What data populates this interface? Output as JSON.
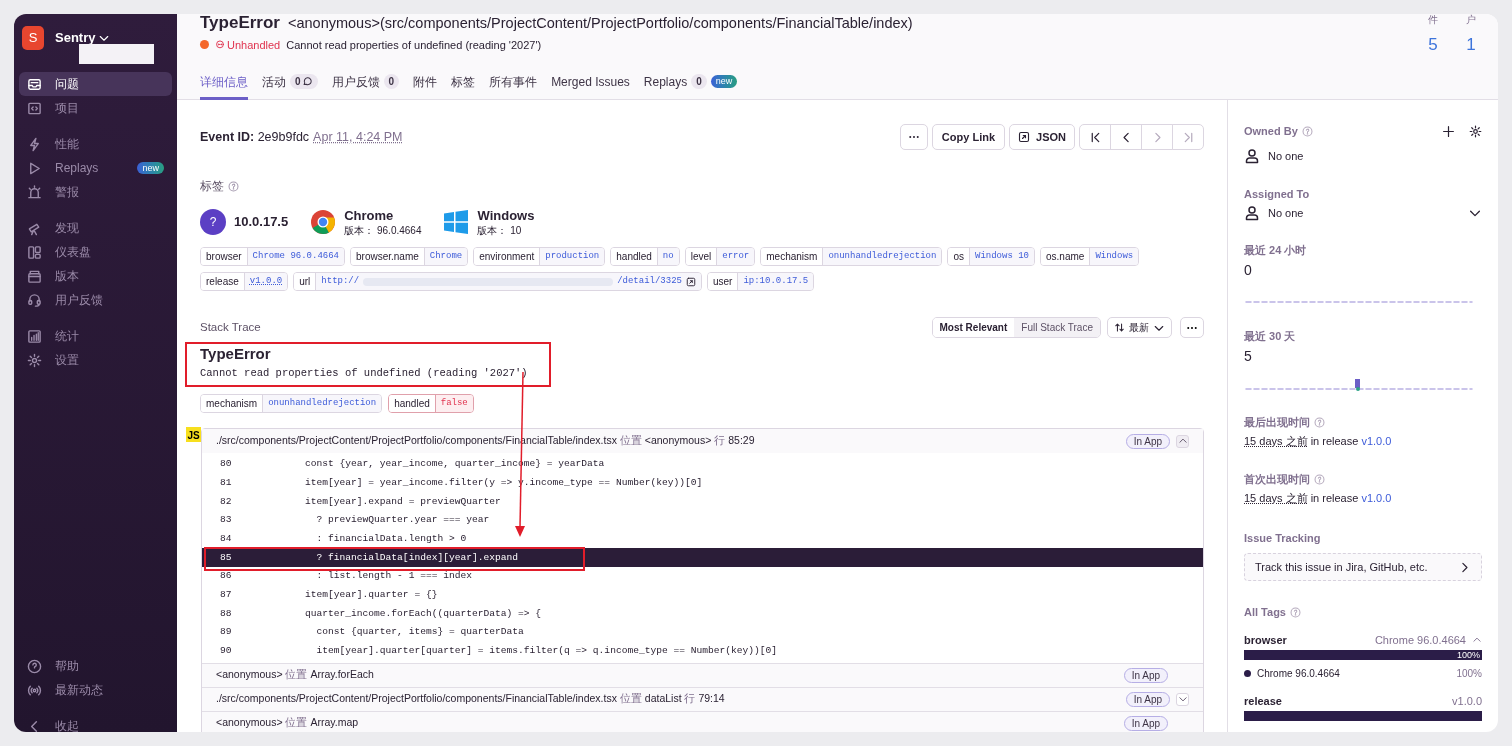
{
  "sidebar": {
    "logo": "S",
    "org": "Sentry",
    "sections": [
      {
        "items": [
          {
            "label": "问题",
            "selected": true
          },
          {
            "label": "项目",
            "selected": false
          }
        ]
      },
      {
        "items": [
          {
            "label": "性能",
            "selected": false
          },
          {
            "label": "Replays",
            "selected": false,
            "badge": "new"
          },
          {
            "label": "警报",
            "selected": false
          }
        ]
      },
      {
        "items": [
          {
            "label": "发现",
            "selected": false
          },
          {
            "label": "仪表盘",
            "selected": false
          },
          {
            "label": "版本",
            "selected": false
          },
          {
            "label": "用户反馈",
            "selected": false
          }
        ]
      },
      {
        "items": [
          {
            "label": "统计",
            "selected": false
          },
          {
            "label": "设置",
            "selected": false
          }
        ]
      }
    ],
    "footer": [
      "帮助",
      "最新动态",
      "收起"
    ]
  },
  "header": {
    "title": "TypeError",
    "subtitle": "<anonymous>(src/components/ProjectContent/ProjectPortfolio/components/FinancialTable/index)",
    "status": "Unhandled",
    "message": "Cannot read properties of undefined (reading '2027')",
    "counts": [
      {
        "label": "件",
        "value": "5"
      },
      {
        "label": "户",
        "value": "1"
      }
    ],
    "tabs": [
      {
        "label": "详细信息",
        "selected": true
      },
      {
        "label": "活动",
        "count": "0",
        "kind": "comments",
        "selected": false
      },
      {
        "label": "用户反馈",
        "count": "0",
        "selected": false
      },
      {
        "label": "附件",
        "selected": false
      },
      {
        "label": "标签",
        "selected": false
      },
      {
        "label": "所有事件",
        "selected": false
      },
      {
        "label": "Merged Issues",
        "selected": false
      },
      {
        "label": "Replays",
        "count": "0",
        "badge": "new",
        "selected": false
      }
    ]
  },
  "event": {
    "id_label": "Event ID:",
    "id": "2e9b9fdc",
    "time": "Apr 11, 4:24 PM",
    "buttons": [
      "Copy Link",
      "JSON"
    ]
  },
  "tags": {
    "title": "标签",
    "highlights": [
      {
        "kind": "user",
        "avatar": "?",
        "title": "10.0.17.5"
      },
      {
        "kind": "browser",
        "title": "Chrome",
        "version_label": "版本：",
        "version": "96.0.4664"
      },
      {
        "kind": "os",
        "title": "Windows",
        "version_label": "版本：",
        "version": "10"
      }
    ],
    "pills": [
      {
        "key": "browser",
        "value": "Chrome 96.0.4664"
      },
      {
        "key": "browser.name",
        "value": "Chrome"
      },
      {
        "key": "environment",
        "value": "production"
      },
      {
        "key": "handled",
        "value": "no"
      },
      {
        "key": "level",
        "value": "error"
      },
      {
        "key": "mechanism",
        "value": "onunhandledrejection"
      },
      {
        "key": "os",
        "value": "Windows 10"
      },
      {
        "key": "os.name",
        "value": "Windows"
      },
      {
        "key": "release",
        "value": "v1.0.0",
        "kind": "release"
      },
      {
        "key": "url",
        "value": "http://",
        "value_end": "/detail/3325",
        "kind": "url"
      },
      {
        "key": "user",
        "value": "ip:10.0.17.5"
      }
    ]
  },
  "stack_trace": {
    "title": "Stack Trace",
    "views": [
      {
        "label": "Most Relevant",
        "selected": true
      },
      {
        "label": "Full Stack Trace",
        "selected": false
      }
    ],
    "sort": "最新",
    "exception_type": "TypeError",
    "exception_value": "Cannot read properties of undefined (reading '2027')",
    "mechanism": [
      {
        "key": "mechanism",
        "value": "onunhandledrejection",
        "alert": false
      },
      {
        "key": "handled",
        "value": "false",
        "alert": true
      }
    ],
    "platform": "JS",
    "frames": [
      {
        "file": "./src/components/ProjectContent/ProjectPortfolio/components/FinancialTable/index.tsx",
        "at": "位置",
        "function": "<anonymous>",
        "line_label": "行",
        "line": "85:29",
        "in_app": "In App",
        "expanded": true,
        "code": [
          {
            "num": "80",
            "text": "const {year, year_income, quarter_income} = yearData",
            "selected": false
          },
          {
            "num": "81",
            "text": "item[year] = year_income.filter(y => y.income_type == Number(key))[0]",
            "selected": false
          },
          {
            "num": "82",
            "text": "item[year].expand = previewQuarter",
            "selected": false
          },
          {
            "num": "83",
            "text": "  ? previewQuarter.year === year",
            "selected": false
          },
          {
            "num": "84",
            "text": "  : financialData.length > 0",
            "selected": false
          },
          {
            "num": "85",
            "text": "  ? financialData[index][year].expand",
            "selected": true
          },
          {
            "num": "86",
            "text": "  : list.length - 1 === index",
            "selected": false
          },
          {
            "num": "87",
            "text": "item[year].quarter = {}",
            "selected": false
          },
          {
            "num": "88",
            "text": "quarter_income.forEach((quarterData) => {",
            "selected": false
          },
          {
            "num": "89",
            "text": "  const {quarter, items} = quarterData",
            "selected": false
          },
          {
            "num": "90",
            "text": "  item[year].quarter[quarter] = items.filter(q => q.income_type == Number(key))[0]",
            "selected": false
          }
        ]
      },
      {
        "file": "<anonymous>",
        "at": "位置",
        "function": "Array.forEach",
        "in_app": "In App"
      },
      {
        "file": "./src/components/ProjectContent/ProjectPortfolio/components/FinancialTable/index.tsx",
        "at": "位置",
        "function": "dataList",
        "line_label": "行",
        "line": "79:14",
        "in_app": "In App",
        "expanded": false
      },
      {
        "file": "<anonymous>",
        "at": "位置",
        "function": "Array.map",
        "in_app": "In App"
      }
    ]
  },
  "side": {
    "owned_by": {
      "title": "Owned By",
      "value": "No one"
    },
    "assigned_to": {
      "title": "Assigned To",
      "value": "No one"
    },
    "stats": [
      {
        "title": "最近 24 小时",
        "value": "0"
      },
      {
        "title": "最近 30 天",
        "value": "5"
      }
    ],
    "seen": [
      {
        "title": "最后出现时间",
        "ago": "15 days 之前",
        "mid": "in release",
        "release": "v1.0.0"
      },
      {
        "title": "首次出现时间",
        "ago": "15 days 之前",
        "mid": "in release",
        "release": "v1.0.0"
      }
    ],
    "issue_tracking": {
      "title": "Issue Tracking",
      "button": "Track this issue in Jira, GitHub, etc."
    },
    "all_tags": {
      "title": "All Tags",
      "tags": [
        {
          "key": "browser",
          "top": "Chrome 96.0.4664",
          "level": 1,
          "percent": "100%",
          "expanded": true,
          "values": [
            {
              "name": "Chrome 96.0.4664",
              "percent": "100%",
              "color": "#2b1d48"
            }
          ]
        },
        {
          "key": "release",
          "top": "v1.0.0",
          "level": 1,
          "expanded": false
        }
      ]
    }
  }
}
